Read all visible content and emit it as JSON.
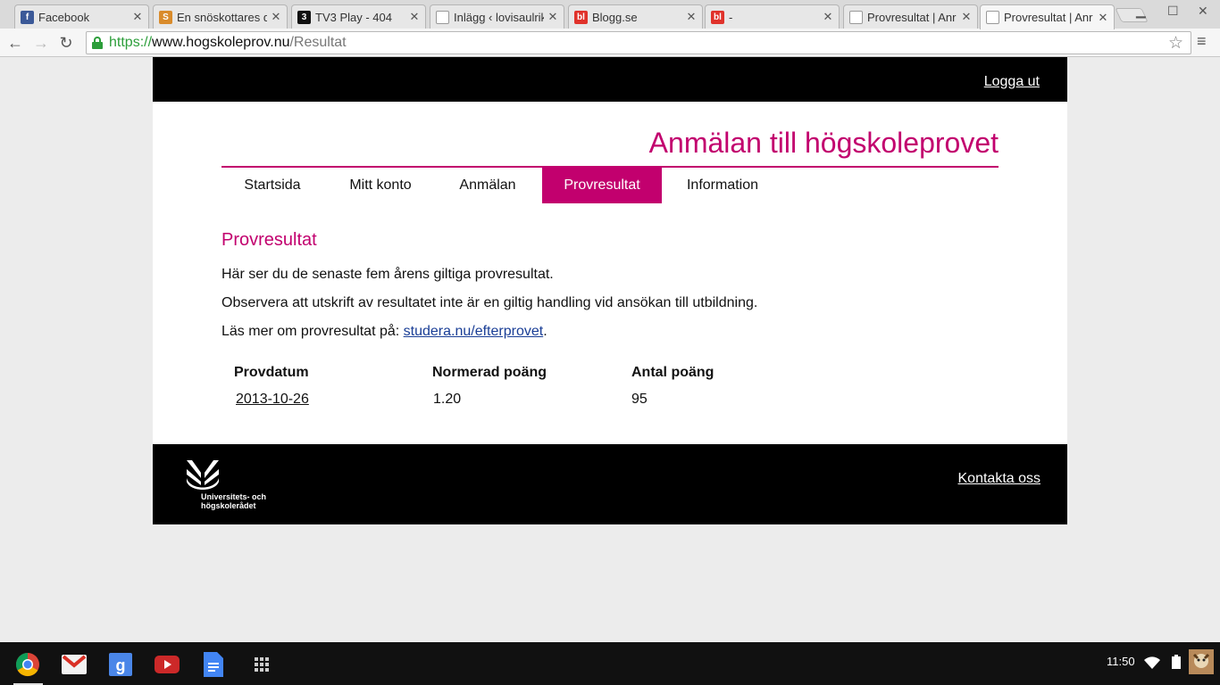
{
  "browser": {
    "tabs": [
      {
        "label": "Facebook",
        "favicon": "f",
        "favicon_color": "#3b5998"
      },
      {
        "label": "En snöskottares d",
        "favicon": "S",
        "favicon_color": "#d98b2b"
      },
      {
        "label": "TV3 Play - 404",
        "favicon": "3",
        "favicon_color": "#111111"
      },
      {
        "label": "Inlägg ‹ lovisaulrik",
        "favicon": "",
        "favicon_color": "#ffffff"
      },
      {
        "label": "Blogg.se",
        "favicon": "bl",
        "favicon_color": "#e0322b"
      },
      {
        "label": "-",
        "favicon": "bl",
        "favicon_color": "#e0322b"
      },
      {
        "label": "Provresultat | Anr",
        "favicon": "",
        "favicon_color": "#ffffff"
      },
      {
        "label": "Provresultat | Anr",
        "favicon": "",
        "favicon_color": "#ffffff"
      }
    ],
    "url": {
      "scheme": "https://",
      "host": "www.hogskoleprov.nu",
      "path": "/Resultat"
    }
  },
  "header": {
    "logout_label": "Logga ut"
  },
  "site_title": "Anmälan till högskoleprovet",
  "nav": [
    {
      "label": "Startsida"
    },
    {
      "label": "Mitt konto"
    },
    {
      "label": "Anmälan"
    },
    {
      "label": "Provresultat"
    },
    {
      "label": "Information"
    }
  ],
  "content": {
    "heading": "Provresultat",
    "para1": "Här ser du de senaste fem årens giltiga provresultat.",
    "para2": "Observera att utskrift av resultatet inte är en giltig handling vid ansökan till utbildning.",
    "para3_prefix": "Läs mer om provresultat på: ",
    "para3_link": "studera.nu/efterprovet",
    "para3_suffix": "."
  },
  "results": {
    "headers": [
      "Provdatum",
      "Normerad poäng",
      "Antal poäng"
    ],
    "rows": [
      [
        "2013-10-26",
        "1.20",
        "95"
      ]
    ]
  },
  "footer": {
    "logo_line1": "Universitets- och",
    "logo_line2": "högskolerådet",
    "contact_label": "Kontakta oss"
  },
  "shelf": {
    "clock": "11:50"
  },
  "colors": {
    "brand": "#c2006e",
    "link": "#1a3e96"
  }
}
